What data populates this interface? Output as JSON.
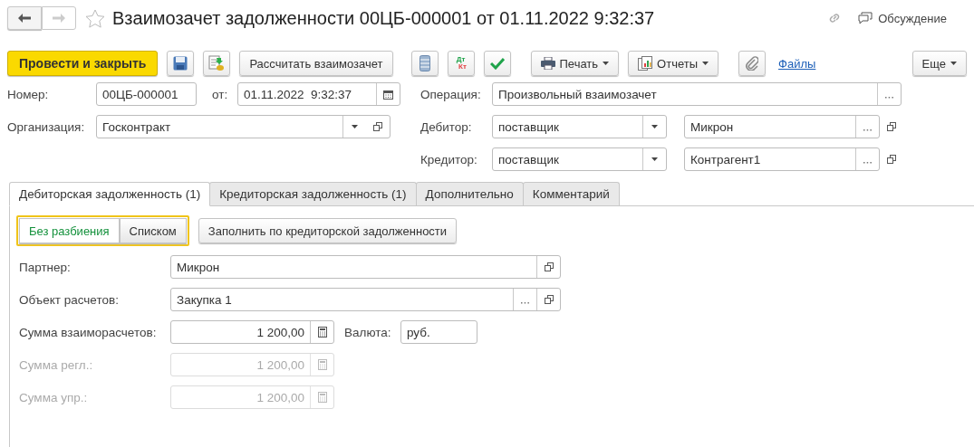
{
  "nav": [
    {
      "kind": "back",
      "disabled": false
    },
    {
      "kind": "forward",
      "disabled": true
    }
  ],
  "favorite": false,
  "title": "Взаимозачет задолженности 00ЦБ-000001 от 01.11.2022 9:32:37",
  "discussion": "Обсуждение",
  "toolbar": [
    {
      "kind": "primary",
      "label": "Провести и закрыть"
    },
    {
      "kind": "save"
    },
    {
      "kind": "load"
    },
    {
      "kind": "button",
      "label": "Рассчитать взаимозачет"
    },
    {
      "kind": "table"
    },
    {
      "kind": "dtkt",
      "top": "Дт",
      "bottom": "Кт"
    },
    {
      "kind": "check"
    },
    {
      "kind": "print",
      "label": "Печать"
    },
    {
      "kind": "reports",
      "label": "Отчеты"
    },
    {
      "kind": "attach"
    },
    {
      "kind": "link",
      "label": "Файлы"
    },
    {
      "kind": "more",
      "label": "Еще"
    }
  ],
  "number": {
    "label": "Номер:",
    "value": "00ЦБ-000001"
  },
  "date": {
    "label": "от:",
    "value": "01.11.2022  9:32:37"
  },
  "organization": {
    "label": "Организация:",
    "value": "Госконтракт"
  },
  "operation": {
    "label": "Операция:",
    "value": "Произвольный взаимозачет"
  },
  "debtor": {
    "label": "Дебитор:",
    "type": "поставщик",
    "value": "Микрон"
  },
  "creditor": {
    "label": "Кредитор:",
    "type": "поставщик",
    "value": "Контрагент1"
  },
  "tabs": [
    {
      "label": "Дебиторская задолженность (1)",
      "selected": true
    },
    {
      "label": "Кредиторская задолженность (1)",
      "selected": false
    },
    {
      "label": "Дополнительно",
      "selected": false
    },
    {
      "label": "Комментарий",
      "selected": false
    }
  ],
  "split_mode": [
    {
      "label": "Без разбиения",
      "selected": true
    },
    {
      "label": "Списком",
      "selected": false
    }
  ],
  "fill_button": "Заполнить по кредиторской задолженности",
  "fields": [
    {
      "kind": "reference",
      "label": "Партнер:",
      "value": "Микрон",
      "disabled": false
    },
    {
      "kind": "choice",
      "label": "Объект расчетов:",
      "value": "Закупка 1",
      "disabled": false
    },
    {
      "kind": "amount",
      "label": "Сумма взаиморасчетов:",
      "value": "1 200,00",
      "disabled": false,
      "currency": {
        "label": "Валюта:",
        "value": "руб."
      }
    },
    {
      "kind": "amount",
      "label": "Сумма регл.:",
      "value": "1 200,00",
      "disabled": true
    },
    {
      "kind": "amount",
      "label": "Сумма упр.:",
      "value": "1 200,00",
      "disabled": true
    }
  ]
}
